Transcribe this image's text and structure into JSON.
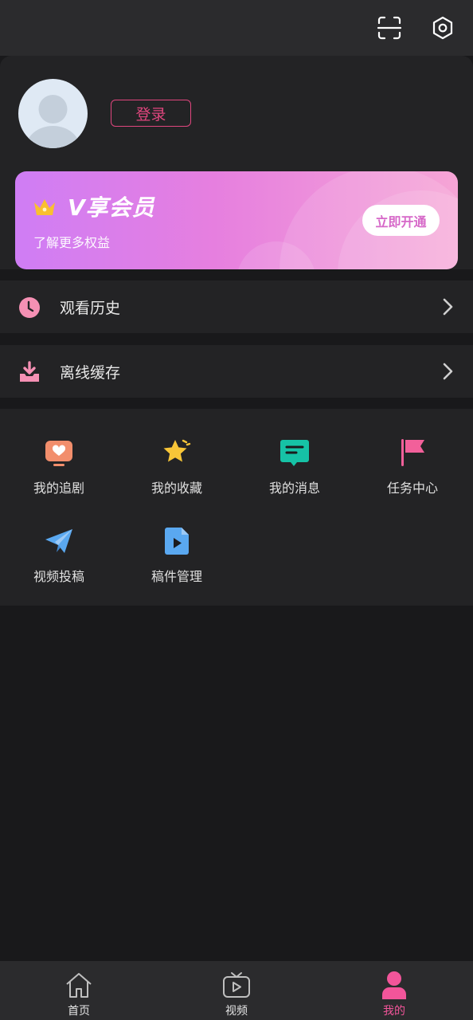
{
  "header": {
    "icons": [
      "scan-icon",
      "gear-icon"
    ]
  },
  "profile": {
    "login_label": "登录"
  },
  "vip": {
    "title": "V享会员",
    "subtitle": "了解更多权益",
    "button_label": "立即开通"
  },
  "rows": [
    {
      "label": "观看历史",
      "icon": "clock-icon"
    },
    {
      "label": "离线缓存",
      "icon": "download-icon"
    }
  ],
  "grid": [
    {
      "label": "我的追剧",
      "icon": "heart-tv-icon",
      "color": "#f28e6c"
    },
    {
      "label": "我的收藏",
      "icon": "star-icon",
      "color": "#f7c538"
    },
    {
      "label": "我的消息",
      "icon": "message-icon",
      "color": "#16c2a6"
    },
    {
      "label": "任务中心",
      "icon": "flag-icon",
      "color": "#f2609a"
    },
    {
      "label": "视频投稿",
      "icon": "paper-plane-icon",
      "color": "#5aa8f0"
    },
    {
      "label": "稿件管理",
      "icon": "video-file-icon",
      "color": "#5aa8f0"
    }
  ],
  "tabs": [
    {
      "label": "首页",
      "icon": "home-icon",
      "active": false
    },
    {
      "label": "视频",
      "icon": "tv-play-icon",
      "active": false
    },
    {
      "label": "我的",
      "icon": "user-icon",
      "active": true
    }
  ],
  "colors": {
    "accent": "#f2559a",
    "background": "#19191b",
    "card": "#232325"
  }
}
